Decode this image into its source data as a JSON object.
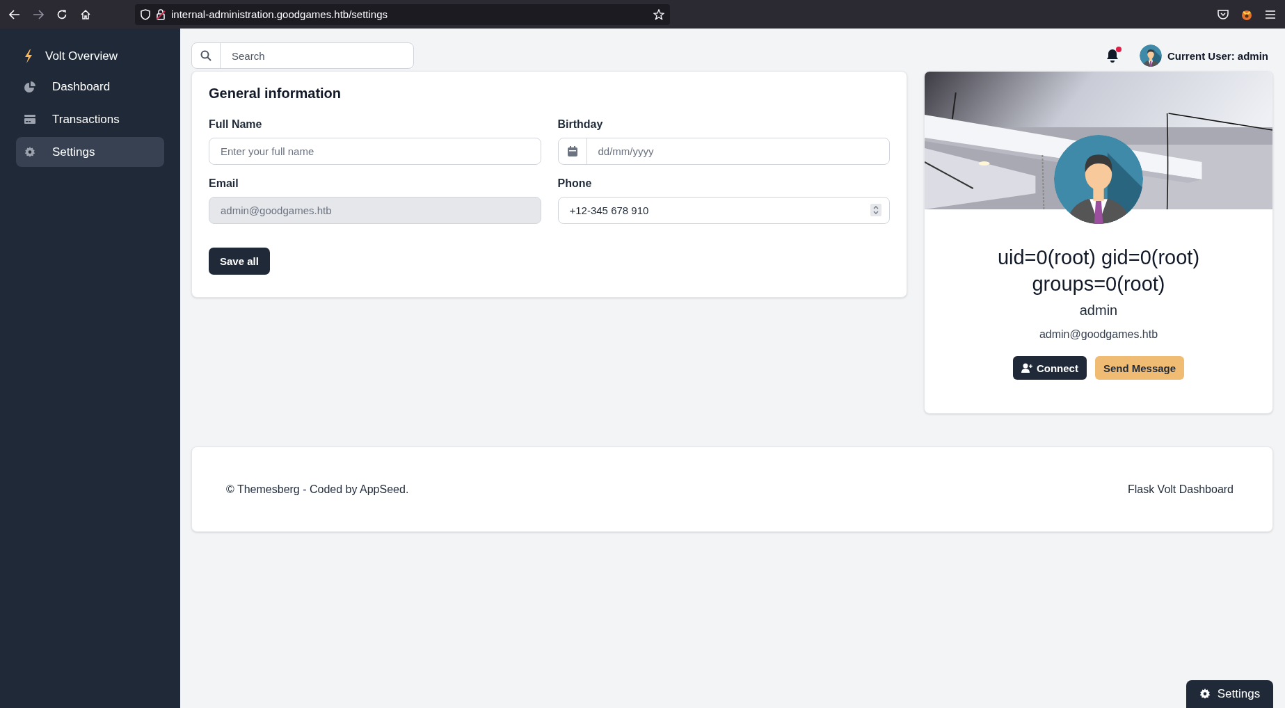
{
  "browser": {
    "url": "internal-administration.goodgames.htb/settings"
  },
  "sidebar": {
    "brand": "Volt Overview",
    "items": [
      {
        "label": "Dashboard",
        "kind": "pie",
        "selected": false
      },
      {
        "label": "Transactions",
        "kind": "card",
        "selected": false
      },
      {
        "label": "Settings",
        "kind": "gear",
        "selected": true
      }
    ]
  },
  "search": {
    "placeholder": "Search"
  },
  "header": {
    "unread": true,
    "user_label": "Current User: admin"
  },
  "form": {
    "title": "General information",
    "fields": [
      {
        "label": "Full Name",
        "kind": "text",
        "placeholder": "Enter your full name",
        "disabled": false
      },
      {
        "label": "Birthday",
        "kind": "date",
        "placeholder": "dd/mm/yyyy",
        "disabled": false
      },
      {
        "label": "Email",
        "kind": "text",
        "value": "admin@goodgames.htb",
        "disabled": true
      },
      {
        "label": "Phone",
        "kind": "number",
        "value": "+12-345 678 910",
        "disabled": false
      }
    ],
    "button": "Save all"
  },
  "profile": {
    "title": "uid=0(root) gid=0(root) groups=0(root)",
    "name": "admin",
    "email": "admin@goodgames.htb",
    "buttons": [
      {
        "label": "Connect",
        "kind": "primary"
      },
      {
        "label": "Send Message",
        "kind": "secondary"
      }
    ]
  },
  "footer": {
    "left": "© Themesberg - Coded by AppSeed.",
    "right": "Flask Volt Dashboard"
  },
  "settings_button": "Settings"
}
